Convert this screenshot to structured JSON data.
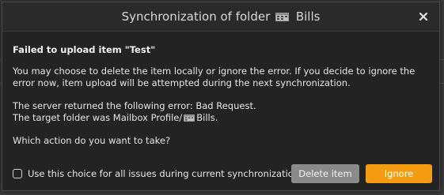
{
  "dialog": {
    "title_prefix": "Synchronization of folder",
    "title_folder": "Bills",
    "close_label": "×"
  },
  "message": {
    "heading": "Failed to upload item \"Test\"",
    "paragraph1": "You may choose to delete the item locally or ignore the error. If you decide to ignore the error now, item upload will be attempted during the next synchronization.",
    "error_line": "The server returned the following error: Bad Request.",
    "folder_line_prefix": "The target folder was Mailbox Profile/",
    "folder_line_folder": "Bills.",
    "question": "Which action do you want to take?"
  },
  "footer": {
    "checkbox_label": "Use this choice for all issues during current synchronization.",
    "checkbox_checked": false,
    "delete_label": "Delete item",
    "ignore_label": "Ignore"
  },
  "colors": {
    "accent": "#f39c12",
    "secondary_button": "#8a8a8a",
    "dialog_bg": "#232323"
  },
  "icons": {
    "folder": "calendar-folder-icon",
    "close": "close-icon"
  }
}
